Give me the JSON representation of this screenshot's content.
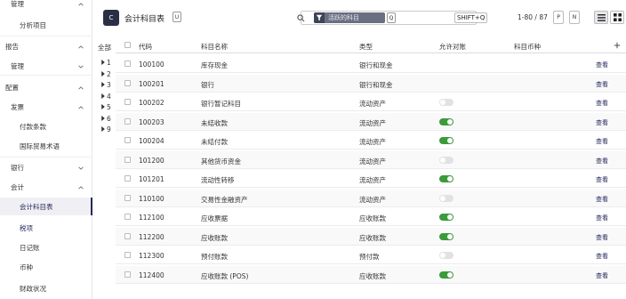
{
  "sidebar": {
    "items": [
      {
        "label": "管理",
        "indent": 1,
        "chev": "up"
      },
      {
        "label": "分析项目",
        "indent": 2
      },
      {
        "label": "报告",
        "indent": 0,
        "chev": "up"
      },
      {
        "label": "管理",
        "indent": 1,
        "chev": "down"
      },
      {
        "label": "配置",
        "indent": 0,
        "chev": "up"
      },
      {
        "label": "发票",
        "indent": 1,
        "chev": "up"
      },
      {
        "label": "付款条款",
        "indent": 2
      },
      {
        "label": "国际贸易术语",
        "indent": 2
      },
      {
        "label": "银行",
        "indent": 1,
        "chev": "down"
      },
      {
        "label": "会计",
        "indent": 1,
        "chev": "up"
      },
      {
        "label": "会计科目表",
        "indent": 2,
        "active": true
      },
      {
        "label": "税项",
        "indent": 2,
        "hover": true
      },
      {
        "label": "日记账",
        "indent": 2
      },
      {
        "label": "币种",
        "indent": 2
      },
      {
        "label": "财政状况",
        "indent": 2
      }
    ]
  },
  "groups": {
    "header": "全部",
    "items": [
      "1",
      "2",
      "3",
      "4",
      "5",
      "6",
      "9"
    ]
  },
  "header": {
    "logo": "C",
    "title": "会计科目表",
    "title_icon": "U",
    "facet_text": "活跃的科目",
    "facet_close": "Q",
    "shortcut": "SHIFT+Q",
    "pager_text": "1-80 / 87",
    "prev": "P",
    "next": "N"
  },
  "table": {
    "columns": [
      "代码",
      "科目名称",
      "类型",
      "允许对账",
      "科目币种"
    ],
    "view_label": "查看",
    "rows": [
      {
        "code": "100100",
        "name": "库存现金",
        "type": "银行和现金",
        "reconcile": null
      },
      {
        "code": "100201",
        "name": "银行",
        "type": "银行和现金",
        "reconcile": null
      },
      {
        "code": "100202",
        "name": "银行暂记科目",
        "type": "流动资产",
        "reconcile": false
      },
      {
        "code": "100203",
        "name": "未结收款",
        "type": "流动资产",
        "reconcile": true
      },
      {
        "code": "100204",
        "name": "未结付款",
        "type": "流动资产",
        "reconcile": true
      },
      {
        "code": "101200",
        "name": "其他货币资金",
        "type": "流动资产",
        "reconcile": false
      },
      {
        "code": "101201",
        "name": "流动性转移",
        "type": "流动资产",
        "reconcile": true
      },
      {
        "code": "110100",
        "name": "交易性金融资产",
        "type": "流动资产",
        "reconcile": false
      },
      {
        "code": "112100",
        "name": "应收票据",
        "type": "应收账款",
        "reconcile": true
      },
      {
        "code": "112200",
        "name": "应收账款",
        "type": "应收账款",
        "reconcile": true
      },
      {
        "code": "112300",
        "name": "预付账款",
        "type": "预付款",
        "reconcile": false
      },
      {
        "code": "112400",
        "name": "应收账款 (POS)",
        "type": "应收账款",
        "reconcile": true
      }
    ]
  },
  "colors": {
    "brand": "#24285c",
    "toggle_on": "#3c9a3c",
    "toggle_off": "#e2e2e2"
  }
}
